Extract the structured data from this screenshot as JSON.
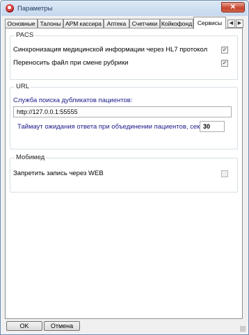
{
  "window": {
    "title": "Параметры",
    "close_label": "✕"
  },
  "tabs": [
    "Основные",
    "Талоны",
    "АРМ кассира",
    "Аптека",
    "Счетчики",
    "Койкофонд",
    "Сервисы"
  ],
  "active_tab": "Сервисы",
  "tab_scroll": {
    "left_label": "◀",
    "right_label": "▶"
  },
  "pacs": {
    "title": "PACS",
    "sync_label": "Синхронизация медицинской информации через HL7 протокол",
    "sync_checked": "✓",
    "move_label": "Переносить файл при смене рубрики",
    "move_checked": "✓"
  },
  "url": {
    "title": "URL",
    "service_label": "Служба поиска дубликатов пациентов:",
    "service_value": "http://127.0.0.1:55555",
    "timeout_label": "Таймаут ожидания ответа при объединении пациентов, сек:",
    "timeout_value": "30"
  },
  "mobimed": {
    "title": "Мобимед",
    "forbid_label": "Запретить запись через WEB"
  },
  "footer": {
    "ok_label": "OK",
    "cancel_label": "Отмена"
  }
}
